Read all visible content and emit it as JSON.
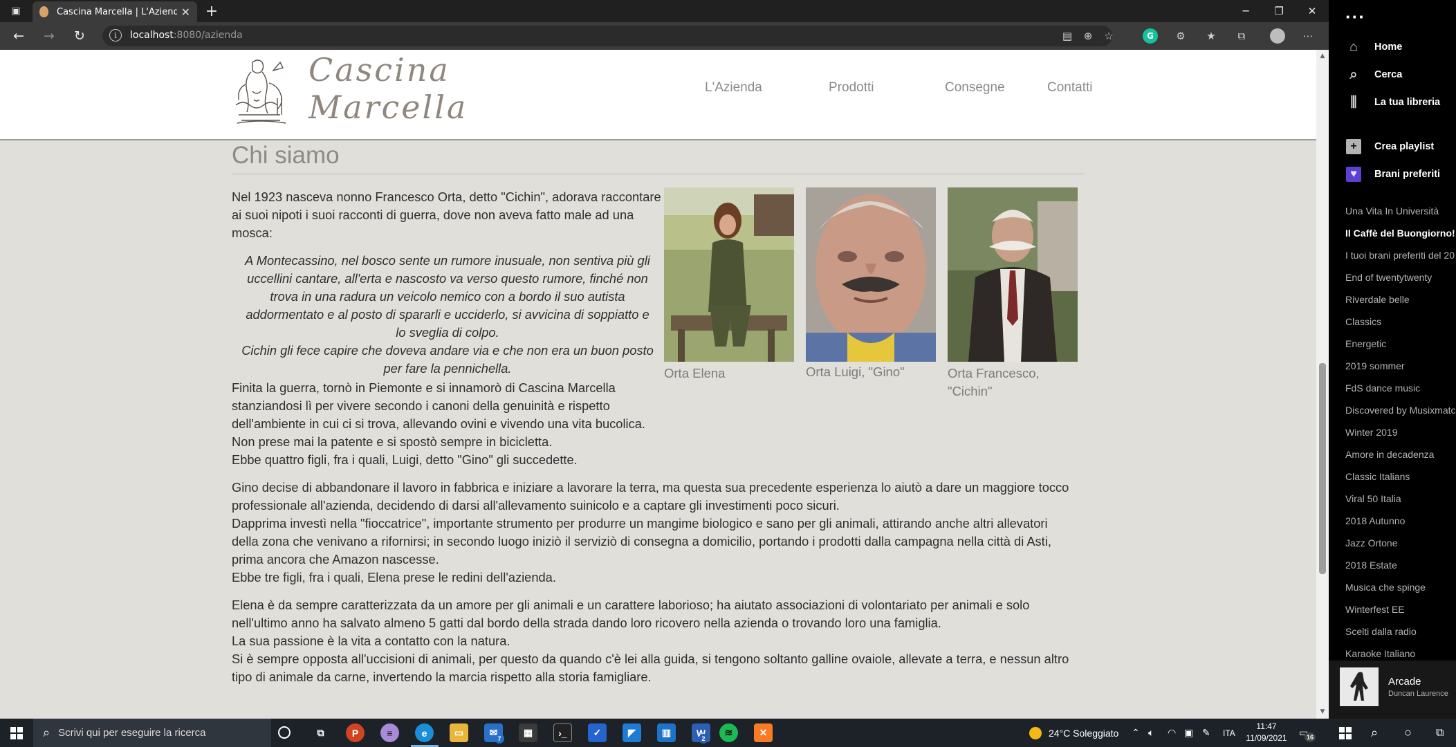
{
  "browser": {
    "tab_title": "Cascina Marcella | L'Azienda",
    "url_host": "localhost",
    "url_path": ":8080/azienda"
  },
  "site": {
    "logo_line1": "Cascina",
    "logo_line2": "Marcella",
    "nav": [
      "L'Azienda",
      "Prodotti",
      "Consegne",
      "Contatti"
    ]
  },
  "section": {
    "title": "Chi siamo",
    "intro_lines": [
      "Nel 1923 nasceva nonno Francesco Orta, detto \"Cichin\", adorava raccontare",
      "ai suoi nipoti i suoi racconti di guerra, dove non aveva fatto male ad una",
      "mosca:"
    ],
    "quote_lines": [
      "A Montecassino, nel bosco sente un rumore inusuale, non sentiva più gli",
      "uccellini cantare, all'erta e nascosto va verso questo rumore, finché non",
      "trova in una radura un veicolo nemico con a bordo il suo autista",
      "addormentato e al posto di spararli e ucciderlo, si avvicina di soppiatto e",
      "lo sveglia di colpo.",
      "Cichin gli fece capire che doveva andare via e che non era un buon posto",
      "per fare la pennichella."
    ],
    "after_quote_lines": [
      "Finita la guerra, tornò in Piemonte e si innamorò di Cascina Marcella",
      "stanziandosi lì per vivere secondo i canoni della genuinità e rispetto",
      "dell'ambiente in cui ci si trova, allevando ovini e vivendo una vita bucolica.",
      "Non prese mai la patente e si spostò sempre in bicicletta.",
      "Ebbe quattro figli, fra i quali, Luigi, detto \"Gino\" gli succedette."
    ],
    "para2_lines": [
      "Gino decise di abbandonare il lavoro in fabbrica e iniziare a lavorare la terra, ma questa sua precedente esperienza lo aiutò a dare un maggiore tocco",
      "professionale all'azienda, decidendo di darsi all'allevamento suinicolo e a captare gli investimenti poco sicuri.",
      "Dapprima investì nella \"fioccatrice\", importante strumento per produrre un mangime biologico e sano per gli animali, attirando anche altri allevatori",
      "della zona che venivano a rifornirsi; in secondo luogo iniziò il serviziò di consegna a domicilio, portando i prodotti dalla campagna nella città di Asti,",
      "prima ancora che Amazon nascesse.",
      "Ebbe tre figli, fra i quali, Elena prese le redini dell'azienda."
    ],
    "para3_lines": [
      "Elena è da sempre caratterizzata da un amore per gli animali e un carattere laborioso; ha aiutato associazioni di volontariato per animali e solo",
      "nell'ultimo anno ha salvato almeno 5 gatti dal bordo della strada dando loro ricovero nella azienda o trovando loro una famiglia.",
      "La sua passione è la vita a contatto con la natura.",
      "Si è sempre opposta all'uccisioni di animali, per questo da quando c'è lei alla guida, si tengono soltanto galline ovaiole, allevate a terra, e nessun altro",
      "tipo di animale da carne, invertendo la marcia rispetto alla storia famigliare."
    ],
    "photos": [
      {
        "caption1": "Orta Elena",
        "caption2": ""
      },
      {
        "caption1": "Orta Luigi, \"Gino\"",
        "caption2": ""
      },
      {
        "caption1": "Orta Francesco,",
        "caption2": "\"Cichin\""
      }
    ]
  },
  "spotify": {
    "nav": [
      "Home",
      "Cerca",
      "La tua libreria"
    ],
    "create_playlist": "Crea playlist",
    "liked": "Brani preferiti",
    "playlists": [
      "Una Vita In Università",
      "Il Caffè del Buongiorno!",
      "I tuoi brani preferiti del 20",
      "End of twentytwenty",
      "Riverdale belle",
      "Classics",
      "Energetic",
      "2019 sommer",
      "FdS dance music",
      "Discovered by Musixmatc",
      "Winter 2019",
      "Amore in decadenza",
      "Classic Italians",
      "Viral 50 Italia",
      "2018 Autunno",
      "Jazz Ortone",
      "2018 Estate",
      "Musica che spinge",
      "Winterfest EE",
      "Scelti dalla radio",
      "Karaoke Italiano"
    ],
    "active_playlist": 1,
    "now_playing_track": "Arcade",
    "now_playing_artist": "Duncan Laurence"
  },
  "taskbar": {
    "search_placeholder": "Scrivi qui per eseguire la ricerca",
    "weather": "24°C  Soleggiato",
    "language": "ITA",
    "time": "11:47",
    "date": "11/09/2021",
    "mail_badge": "7",
    "word_badge": "2",
    "notif_badge": "16"
  }
}
